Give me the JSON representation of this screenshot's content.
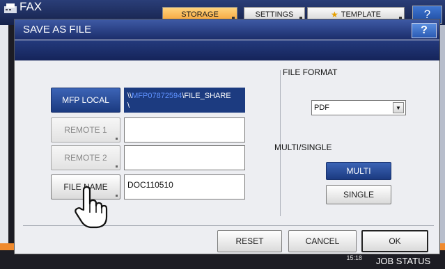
{
  "background": {
    "app_title": "FAX",
    "tabs": [
      {
        "label": "STORAGE"
      },
      {
        "label": "SETTINGS"
      },
      {
        "label": "TEMPLATE"
      }
    ],
    "help_label": "?",
    "job_status_label": "JOB STATUS",
    "clock_time": "15:18"
  },
  "dialog": {
    "title": "SAVE AS FILE",
    "help_label": "?",
    "destinations": [
      {
        "label": "MFP LOCAL",
        "path_prefix": "\\\\",
        "path_blurred": "MFP07872594",
        "path_suffix": "\\FILE_SHARE",
        "path_line2": "\\"
      },
      {
        "label": "REMOTE 1",
        "value": ""
      },
      {
        "label": "REMOTE 2",
        "value": ""
      }
    ],
    "file_name_button": "FILE NAME",
    "file_name_value": "DOC110510",
    "file_format_label": "FILE FORMAT",
    "file_format_value": "PDF",
    "multi_single_label": "MULTI/SINGLE",
    "multi_label": "MULTI",
    "single_label": "SINGLE",
    "reset_label": "RESET",
    "cancel_label": "CANCEL",
    "ok_label": "OK"
  },
  "colors": {
    "accent_blue": "#1c3b80",
    "storage_tab": "#f5a238",
    "status_orange": "#f08a2e"
  },
  "icons": [
    "fax-icon",
    "star-icon",
    "hand-pointer-icon"
  ]
}
